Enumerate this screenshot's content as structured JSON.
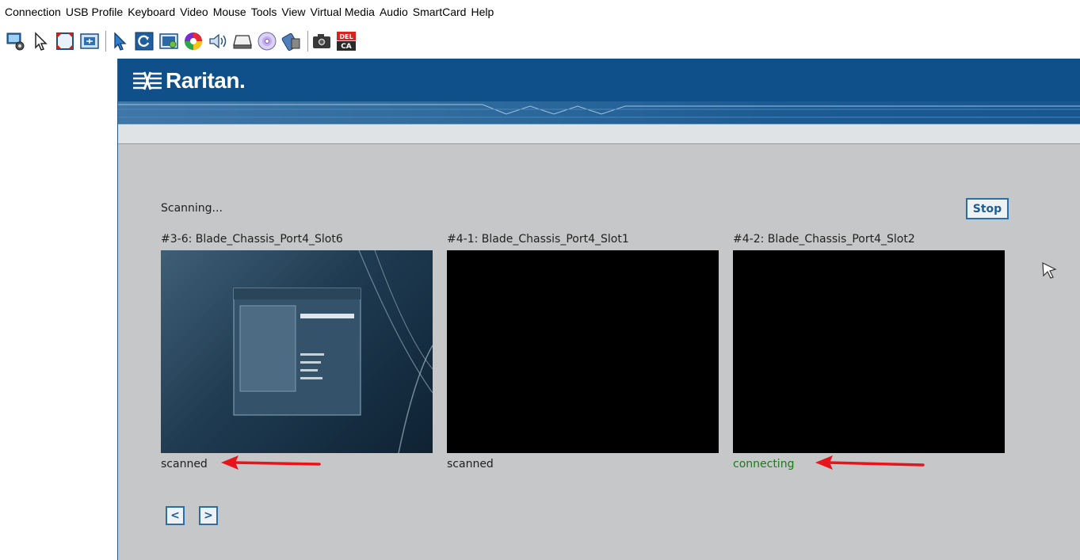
{
  "menu": [
    "Connection",
    "USB Profile",
    "Keyboard",
    "Video",
    "Mouse",
    "Tools",
    "View",
    "Virtual Media",
    "Audio",
    "SmartCard",
    "Help"
  ],
  "toolbar": {
    "icons": [
      "connection-properties-icon",
      "single-cursor-icon",
      "full-screen-icon",
      "scale-video-icon",
      "sync-mouse-icon",
      "refresh-icon",
      "video-settings-icon",
      "color-settings-icon",
      "audio-icon",
      "drive-icon",
      "cd-dvd-icon",
      "smartcard-icon",
      "snapshot-icon",
      "ctrl-alt-del-icon"
    ],
    "del_label": "DEL",
    "ca_label": "CA"
  },
  "header": {
    "brand": "Raritan."
  },
  "scan": {
    "status": "Scanning...",
    "stop_label": "Stop",
    "tiles": [
      {
        "title": "#3-6: Blade_Chassis_Port4_Slot6",
        "status": "scanned",
        "status_color": "#1f1f1f"
      },
      {
        "title": "#4-1: Blade_Chassis_Port4_Slot1",
        "status": "scanned",
        "status_color": "#1f1f1f"
      },
      {
        "title": "#4-2: Blade_Chassis_Port4_Slot2",
        "status": "connecting",
        "status_color": "#1a7a1a"
      }
    ],
    "prev_label": "<",
    "next_label": ">"
  },
  "colors": {
    "header_blue": "#0f4f8a",
    "panel_gray": "#c6c7c8",
    "annotation_red": "#e8141b",
    "button_blue": "#2b6ea6"
  }
}
